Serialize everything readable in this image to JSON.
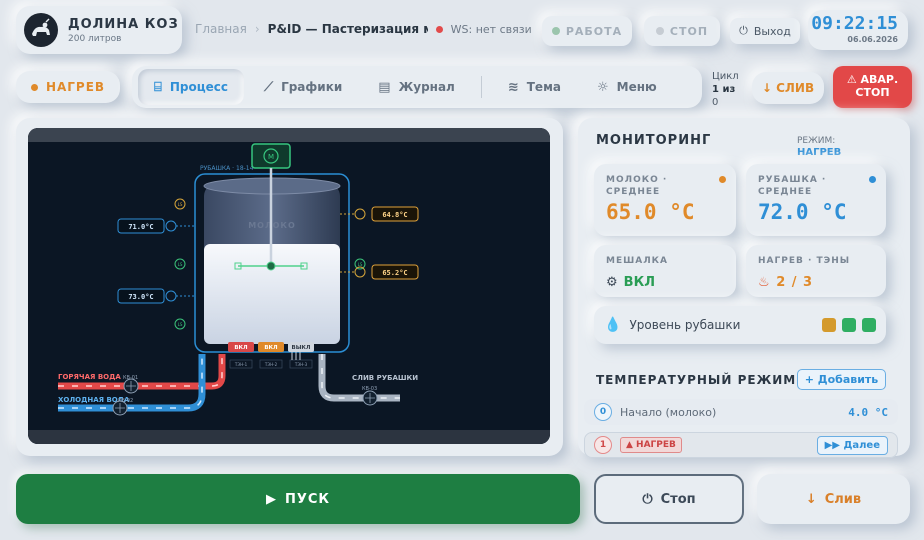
{
  "brand": {
    "name": "ДОЛИНА КОЗ",
    "subtitle": "200 литров"
  },
  "breadcrumb": {
    "home": "Главная",
    "separator": "›",
    "page": "P&ID — Пастеризация мо",
    "ws_status": "WS: нет связи"
  },
  "header": {
    "work_label": "РАБОТА",
    "stop_label": "СТОП",
    "exit_label": "Выход"
  },
  "clock": {
    "time": "09:22:15",
    "date": "06.06.2026"
  },
  "nav": {
    "mode": "НАГРЕВ",
    "tabs": [
      {
        "label": "Процесс",
        "icon": "cylinder-icon",
        "active": true
      },
      {
        "label": "Графики",
        "icon": "chart-icon",
        "active": false
      },
      {
        "label": "Журнал",
        "icon": "journal-icon",
        "active": false
      },
      {
        "label": "Тема",
        "icon": "theme-icon",
        "active": false
      },
      {
        "label": "Меню",
        "icon": "gear-icon",
        "active": false
      }
    ],
    "cycle_label": "Цикл",
    "cycle_value": "1 из",
    "cycle_total": "0",
    "drain_label": "↓ СЛИВ",
    "emergency_line1": "⚠ АВАР.",
    "emergency_line2": "СТОП"
  },
  "pid": {
    "tank_label": "МОЛОКО",
    "jacket_label": "РУБАШКА · 18-14",
    "temp_left_1": "71.0°C",
    "temp_left_2": "73.0°C",
    "temp_right_1": "64.8°C",
    "temp_right_2": "65.2°C",
    "heater_1": "ВКЛ",
    "heater_2": "ВКЛ",
    "heater_3": "ВЫКЛ",
    "heater_tag_1": "ТЭН-1",
    "heater_tag_2": "ТЭН-2",
    "heater_tag_3": "ТЭН-3",
    "hot_water": "ГОРЯЧАЯ ВОДА",
    "cold_water": "ХОЛОДНАЯ ВОДА",
    "valve_1": "КВ-01",
    "valve_2": "КВ-02",
    "valve_3": "КВ-03",
    "jacket_drain": "СЛИВ РУБАШКИ",
    "motor": "M",
    "level_tag": "LS",
    "sensor_tag": "TE"
  },
  "monitoring": {
    "title": "МОНИТОРИНГ",
    "mode_label": "РЕЖИМ:",
    "mode_value": "НАГРЕВ",
    "milk_label": "МОЛОКО · СРЕДНЕЕ",
    "milk_value": "65.0 °C",
    "jacket_label": "РУБАШКА · СРЕДНЕЕ",
    "jacket_value": "72.0 °C",
    "mixer_label": "МЕШАЛКА",
    "mixer_value": "ВКЛ",
    "heat_label": "НАГРЕВ · ТЭНЫ",
    "heat_value": "2 / 3",
    "level_label": "Уровень рубашки",
    "level_colors": [
      "#d49a2c",
      "#2fae62",
      "#2fae62"
    ]
  },
  "temp_regime": {
    "title": "ТЕМПЕРАТУРНЫЙ РЕЖИМ",
    "add_label": "+ Добавить",
    "steps": [
      {
        "num": "0",
        "label": "Начало (молоко)",
        "value": "4.0 °C"
      },
      {
        "num": "1",
        "label": "▲ НАГРЕВ",
        "action": "▶▶ Далее"
      }
    ]
  },
  "controls": {
    "start_label": "ПУСК",
    "stop_label": "Стоп",
    "drain_label": "Слив"
  },
  "colors": {
    "accent": "#2f8fd6",
    "heat": "#e08a2a",
    "danger": "#e24848",
    "ok": "#1e7e42"
  }
}
